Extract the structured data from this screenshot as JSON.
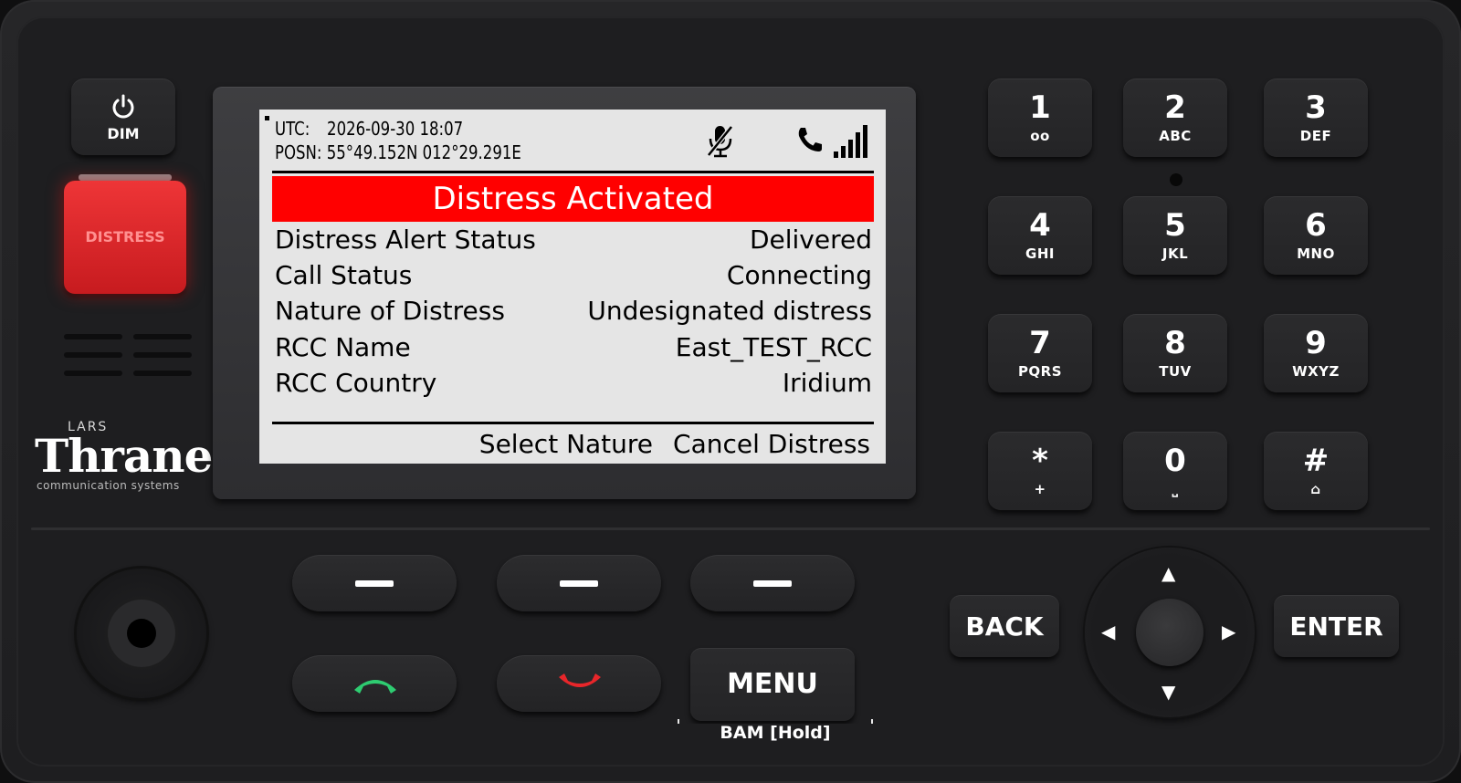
{
  "colors": {
    "distress_red": "#ff0000",
    "screen_bg": "#e5e5e5",
    "device_body": "#1e1e20",
    "accept_green": "#2ecc71",
    "reject_red": "#e8262a"
  },
  "dim_button": {
    "label": "DIM",
    "icon": "power-icon"
  },
  "distress_button": {
    "label": "DISTRESS"
  },
  "brand": {
    "small": "LARS",
    "big": "Thrane",
    "sub": "communication systems"
  },
  "screen": {
    "utc_label": "UTC:",
    "utc_value": "2026-09-30 18:07",
    "posn_label": "POSN:",
    "posn_value": "55°49.152N 012°29.291E",
    "status_icons": [
      "mic-muted-icon",
      "phone-icon",
      "signal-strength-icon"
    ],
    "banner": "Distress Activated",
    "rows": [
      {
        "label": "Distress Alert Status",
        "value": "Delivered"
      },
      {
        "label": "Call Status",
        "value": "Connecting"
      },
      {
        "label": "Nature of Distress",
        "value": "Undesignated distress"
      },
      {
        "label": "RCC Name",
        "value": "East_TEST_RCC"
      },
      {
        "label": "RCC Country",
        "value": "Iridium"
      }
    ],
    "softkeys": [
      "Select Nature",
      "Cancel Distress"
    ]
  },
  "keypad": [
    {
      "digit": "1",
      "sub": "oo"
    },
    {
      "digit": "2",
      "sub": "ABC"
    },
    {
      "digit": "3",
      "sub": "DEF"
    },
    {
      "digit": "4",
      "sub": "GHI"
    },
    {
      "digit": "5",
      "sub": "JKL"
    },
    {
      "digit": "6",
      "sub": "MNO"
    },
    {
      "digit": "7",
      "sub": "PQRS"
    },
    {
      "digit": "8",
      "sub": "TUV"
    },
    {
      "digit": "9",
      "sub": "WXYZ"
    },
    {
      "digit": "*",
      "sub": "+"
    },
    {
      "digit": "0",
      "sub": "⎵"
    },
    {
      "digit": "#",
      "sub": "⌂"
    }
  ],
  "controls": {
    "menu": "MENU",
    "bam": "BAM [Hold]",
    "back": "BACK",
    "enter": "ENTER",
    "dpad_arrows": {
      "up": "▲",
      "down": "▼",
      "left": "◀",
      "right": "▶"
    }
  }
}
